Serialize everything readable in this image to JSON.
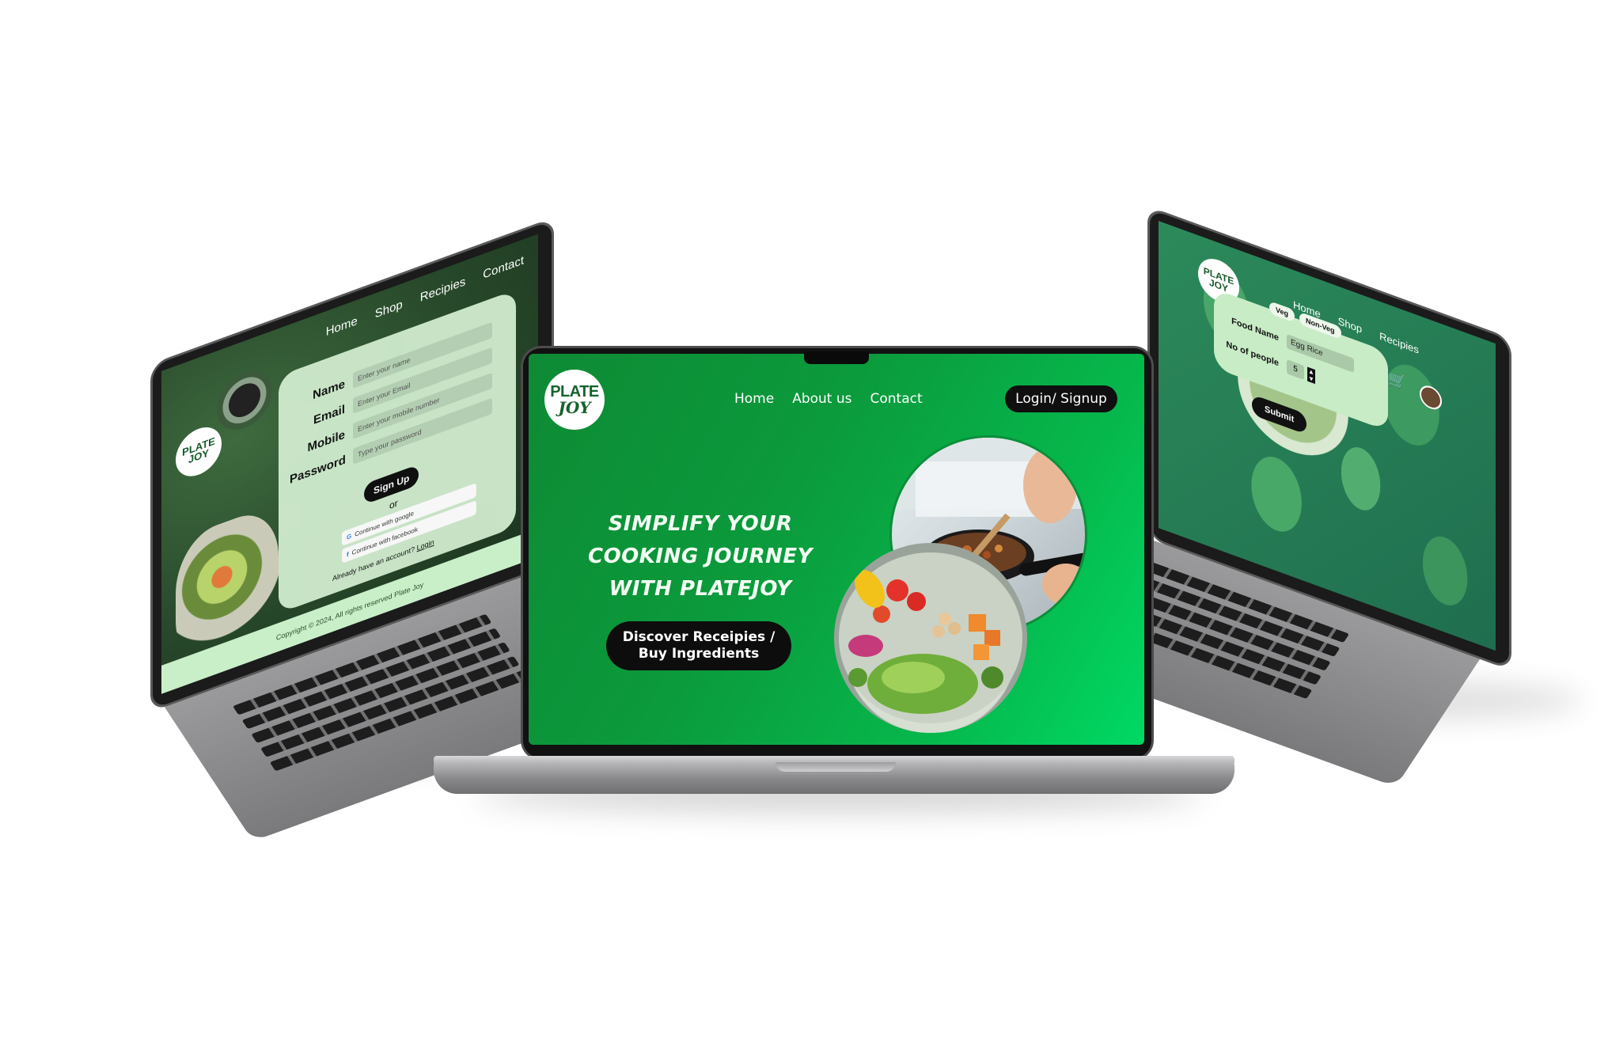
{
  "center": {
    "logo": {
      "line1": "PLATE",
      "line2": "JOY"
    },
    "nav": [
      "Home",
      "About us",
      "Contact"
    ],
    "login_label": "Login/ Signup",
    "hero_lines": [
      "SIMPLIFY YOUR",
      "COOKING JOURNEY",
      "WITH PLATEJOY"
    ],
    "cta_lines": [
      "Discover Receipies /",
      "Buy Ingredients"
    ]
  },
  "left": {
    "logo": {
      "line1": "PLATE",
      "line2": "JOY"
    },
    "nav": [
      "Home",
      "Shop",
      "Recipies",
      "Contact"
    ],
    "form": {
      "fields": [
        {
          "label": "Name",
          "placeholder": "Enter your name"
        },
        {
          "label": "Email",
          "placeholder": "Enter your Email"
        },
        {
          "label": "Mobile",
          "placeholder": "Enter your mobile number"
        },
        {
          "label": "Password",
          "placeholder": "Type your password"
        }
      ],
      "signup_label": "Sign Up",
      "or_label": "or",
      "google_label": "Continue with google",
      "facebook_label": "Continue with facebook",
      "already_text": "Already have an account?",
      "login_link": "Login"
    },
    "footer": "Copyright © 2024, All rights reserved Plate Joy"
  },
  "right": {
    "logo": {
      "line1": "PLATE",
      "line2": "JOY"
    },
    "nav": [
      "Home",
      "Shop",
      "Recipies"
    ],
    "toggle": {
      "veg": "Veg",
      "nonveg": "Non-Veg"
    },
    "food_label": "Food Name",
    "food_value": "Egg Rice",
    "people_label": "No of people",
    "people_value": "5",
    "submit_label": "Submit"
  },
  "colors": {
    "brand_green": "#0b9a3c",
    "accent_black": "#0d0d0d"
  }
}
